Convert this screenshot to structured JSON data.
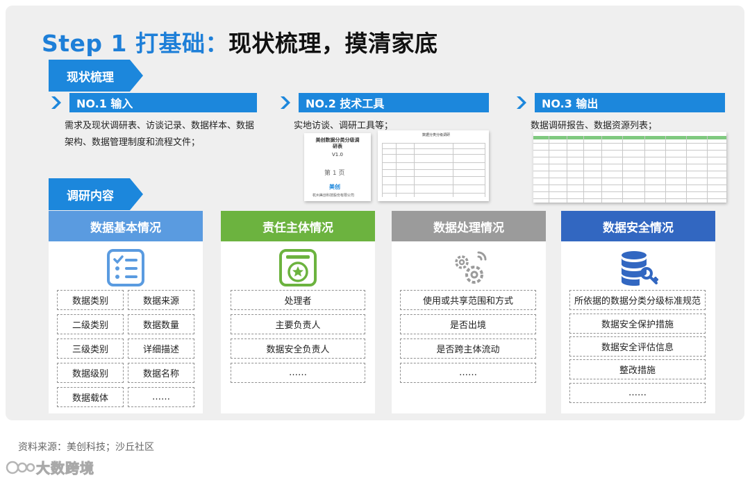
{
  "title": {
    "step": "Step 1 打基础：",
    "rest": "现状梳理，摸清家底"
  },
  "banners": {
    "current_status": "现状梳理",
    "research_content": "调研内容"
  },
  "steps": [
    {
      "no": "NO.1 输入",
      "desc": "需求及现状调研表、访谈记录、数据样本、数据架构、数据管理制度和流程文件；"
    },
    {
      "no": "NO.2 技术工具",
      "desc": "实地访谈、调研工具等；"
    },
    {
      "no": "NO.3 输出",
      "desc": "数据调研报告、数据资源列表；"
    }
  ],
  "doc_cover": {
    "title": "美创数据分类分级调研表",
    "version": "V1.0",
    "page": "第 1 页",
    "brand": "美创",
    "footer": "杭州美创科技股份有限公司"
  },
  "doc_table": {
    "title": "数据分类分级调研"
  },
  "cards": [
    {
      "name": "数据基本情况",
      "color": "#5a9be0",
      "icon": "checklist-icon",
      "cells": [
        "数据类别",
        "数据来源",
        "二级类别",
        "数据数量",
        "三级类别",
        "详细描述",
        "数据级别",
        "数据名称",
        "数据载体",
        "……"
      ]
    },
    {
      "name": "责任主体情况",
      "color": "#6cb33f",
      "icon": "certificate-star-icon",
      "cells": [
        "处理者",
        "主要负责人",
        "数据安全负责人",
        "……"
      ]
    },
    {
      "name": "数据处理情况",
      "color": "#9b9b9b",
      "icon": "gears-icon",
      "cells": [
        "使用或共享范围和方式",
        "是否出境",
        "是否跨主体流动",
        "……"
      ]
    },
    {
      "name": "数据安全情况",
      "color": "#3267c1",
      "icon": "database-key-icon",
      "cells": [
        "所依据的数据分类分级标准规范",
        "数据安全保护措施",
        "数据安全评估信息",
        "整改措施",
        "……"
      ]
    }
  ],
  "colors": {
    "accent": "#1c87dc",
    "title_blue": "#1e7fd8"
  },
  "source": "资料来源：美创科技；沙丘社区",
  "watermark": "大数跨境"
}
